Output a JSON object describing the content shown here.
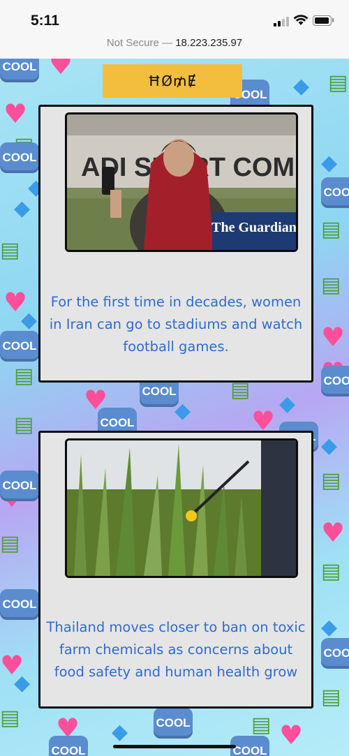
{
  "status_bar": {
    "time": "5:11",
    "signal_icon": "cellular-signal-icon",
    "wifi_icon": "wifi-icon",
    "battery_icon": "battery-icon"
  },
  "url_bar": {
    "security_label": "Not Secure —",
    "host": "18.223.235.97"
  },
  "background": {
    "pattern": "emoji-collage",
    "emoji_icons": [
      "cool-button-icon",
      "heart-icon",
      "droplet-icon",
      "money-with-wings-icon"
    ],
    "cool_label": "COOL"
  },
  "nav": {
    "home_label": "ĦØ₥Ɇ",
    "home_color": "#f3bd3d"
  },
  "articles": [
    {
      "image_label": "Woman in red headscarf holding phone at stadium",
      "image_overlay_sign": "ADI SPORT COM",
      "image_badge": "The Guardian",
      "headline": "For the first time in decades, women in Iran can go to stadiums and watch football games."
    },
    {
      "image_label": "Farmer spraying chemicals on sugarcane field",
      "headline": "Thailand moves closer to ban on toxic farm chemicals as concerns about food safety and human health grow"
    }
  ],
  "colors": {
    "link_text": "#2f6bd0",
    "card_bg": "#e5e5e5",
    "card_border": "#0c0c0c"
  }
}
